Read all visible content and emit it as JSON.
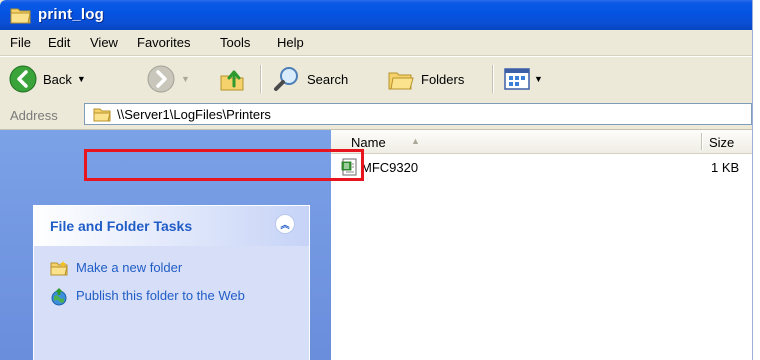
{
  "window": {
    "title": "print_log",
    "accent_color": "#0a4fd5"
  },
  "menubar": {
    "items": [
      {
        "label": "File"
      },
      {
        "label": "Edit"
      },
      {
        "label": "View"
      },
      {
        "label": "Favorites"
      },
      {
        "label": "Tools"
      },
      {
        "label": "Help"
      }
    ]
  },
  "toolbar": {
    "back_label": "Back",
    "search_label": "Search",
    "folders_label": "Folders",
    "icons": [
      "back-arrow-icon",
      "forward-arrow-icon",
      "up-folder-icon",
      "search-magnifier-icon",
      "folders-icon",
      "views-icon"
    ]
  },
  "address": {
    "label": "Address",
    "value": "\\\\Server1\\LogFiles\\Printers",
    "highlight_color": "#e8141e"
  },
  "tasks": {
    "title": "File and Folder Tasks",
    "items": [
      {
        "label": "Make a new folder",
        "icon": "new-folder-icon"
      },
      {
        "label": "Publish this folder to the Web",
        "icon": "publish-web-icon"
      }
    ]
  },
  "file_list": {
    "columns": [
      {
        "label": "Name"
      },
      {
        "label": "Size"
      }
    ],
    "sort_icon": "sort-ascending-icon",
    "rows": [
      {
        "name": "MFC9320",
        "size": "1 KB",
        "icon": "text-file-icon"
      }
    ]
  }
}
